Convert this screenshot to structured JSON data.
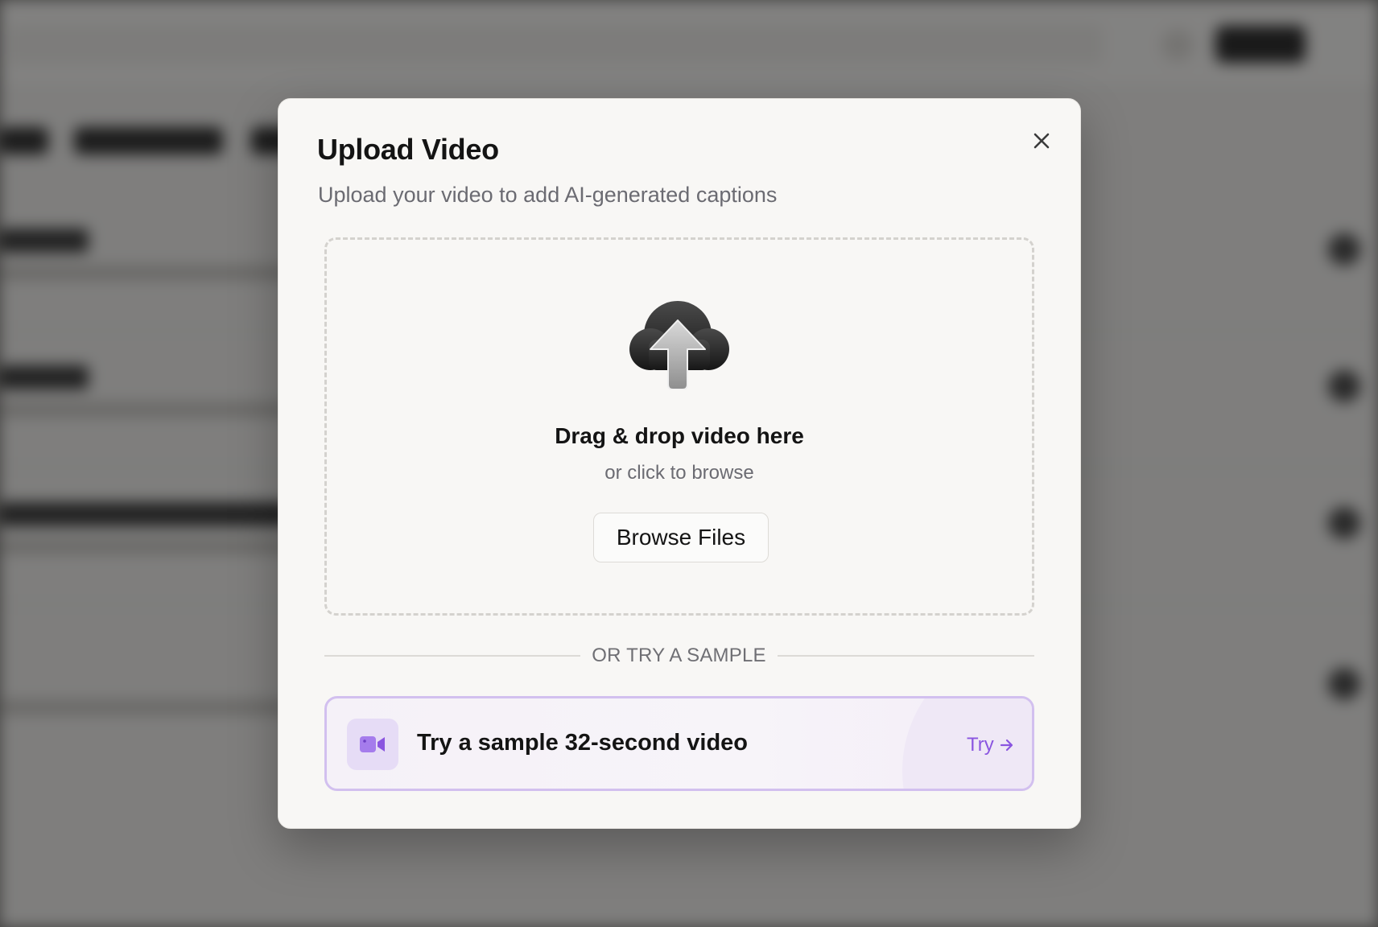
{
  "modal": {
    "title": "Upload Video",
    "subtitle": "Upload your video to add AI-generated captions",
    "close_icon": "close-icon"
  },
  "dropzone": {
    "icon": "cloud-upload-icon",
    "title": "Drag & drop video here",
    "subtitle": "or click to browse",
    "browse_label": "Browse Files"
  },
  "divider": {
    "label": "OR TRY A SAMPLE"
  },
  "sample": {
    "icon": "video-camera-icon",
    "label": "Try a sample 32-second video",
    "action_label": "Try",
    "action_icon": "arrow-right-icon"
  },
  "colors": {
    "accent": "#8a55e0",
    "sample_border": "#d2c0ef",
    "sample_icon_bg": "#e6dcf6",
    "modal_bg": "#f8f7f5"
  }
}
